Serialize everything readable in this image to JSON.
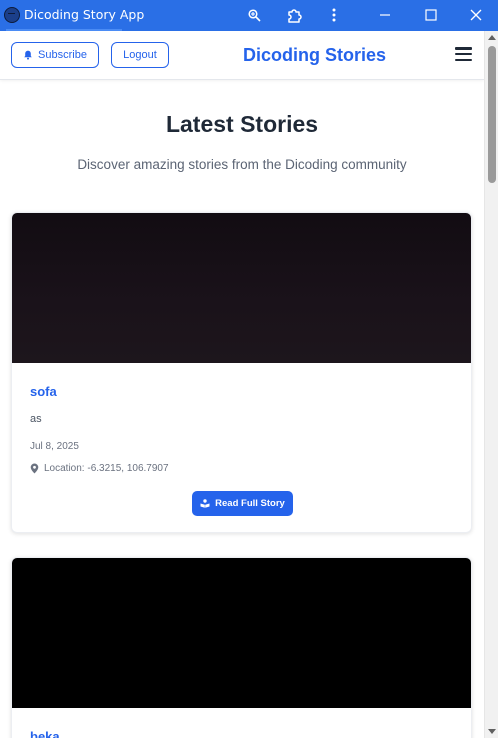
{
  "window": {
    "title": "Dicoding Story App",
    "icons": {
      "zoom": "zoom-icon",
      "extensions": "puzzle-icon",
      "more": "more-vertical-icon",
      "minimize": "minimize-icon",
      "maximize": "maximize-icon",
      "close": "close-icon"
    }
  },
  "header": {
    "subscribe_label": "Subscribe",
    "logout_label": "Logout",
    "brand": "Dicoding Stories",
    "menu_icon": "hamburger-icon"
  },
  "hero": {
    "title": "Latest Stories",
    "subtitle": "Discover amazing stories from the Dicoding community"
  },
  "stories": [
    {
      "title": "sofa",
      "description": "as",
      "date": "Jul 8, 2025",
      "location": "Location: -6.3215, 106.7907",
      "button_label": "Read Full Story"
    },
    {
      "title": "beka"
    }
  ],
  "colors": {
    "accent": "#2563eb",
    "titlebar": "#2a6fe6",
    "heading": "#1f2937"
  }
}
